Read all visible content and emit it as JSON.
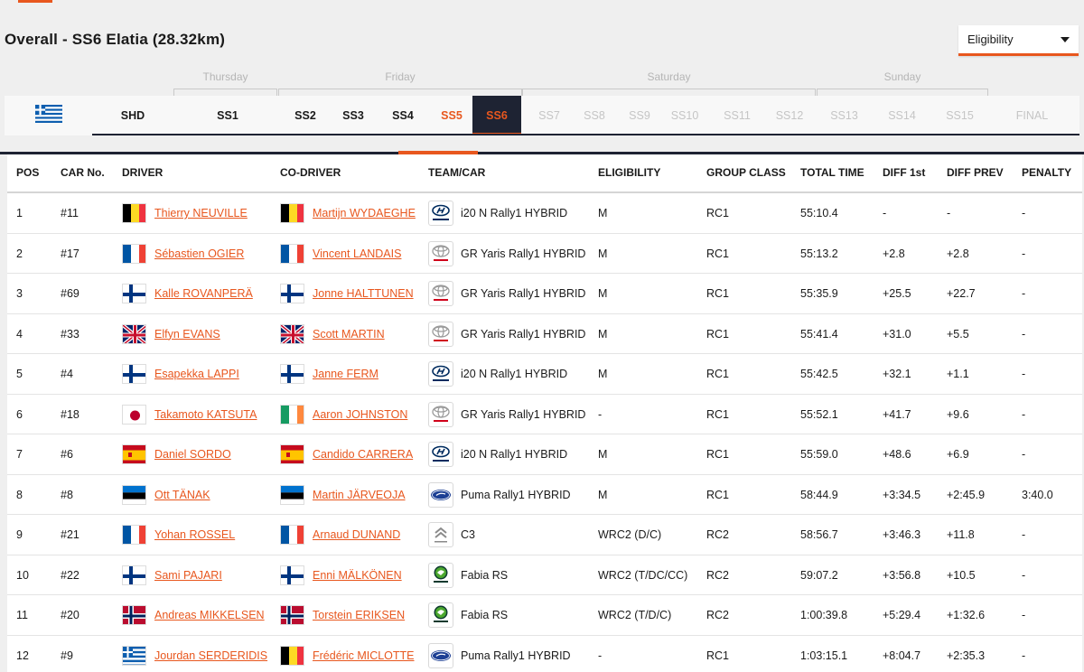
{
  "header": {
    "title": "Overall - SS6 Elatia (28.32km)",
    "eligibility_select": "Eligibility"
  },
  "days": [
    "Thursday",
    "Friday",
    "Saturday",
    "Sunday"
  ],
  "stages": [
    {
      "label": "SHD",
      "state": "done"
    },
    {
      "label": "SS1",
      "state": "done"
    },
    {
      "label": "SS2",
      "state": "done"
    },
    {
      "label": "SS3",
      "state": "done"
    },
    {
      "label": "SS4",
      "state": "done"
    },
    {
      "label": "SS5",
      "state": "prev"
    },
    {
      "label": "SS6",
      "state": "active"
    },
    {
      "label": "SS7",
      "state": "future"
    },
    {
      "label": "SS8",
      "state": "future"
    },
    {
      "label": "SS9",
      "state": "future"
    },
    {
      "label": "SS10",
      "state": "future"
    },
    {
      "label": "SS11",
      "state": "future"
    },
    {
      "label": "SS12",
      "state": "future"
    },
    {
      "label": "SS13",
      "state": "future"
    },
    {
      "label": "SS14",
      "state": "future"
    },
    {
      "label": "SS15",
      "state": "future"
    },
    {
      "label": "FINAL",
      "state": "future"
    }
  ],
  "columns": [
    "POS",
    "CAR No.",
    "DRIVER",
    "CO-DRIVER",
    "TEAM/CAR",
    "ELIGIBILITY",
    "GROUP CLASS",
    "TOTAL TIME",
    "DIFF 1st",
    "DIFF PREV",
    "PENALTY"
  ],
  "rows": [
    {
      "pos": "1",
      "car": "#11",
      "driver": "Thierry NEUVILLE",
      "driver_flag": "BE",
      "codriver": "Martijn WYDAEGHE",
      "codriver_flag": "BE",
      "team_logo": "hyundai",
      "team": "i20 N Rally1 HYBRID",
      "elig": "M",
      "group": "RC1",
      "total": "55:10.4",
      "diff1": "-",
      "diffprev": "-",
      "penalty": "-"
    },
    {
      "pos": "2",
      "car": "#17",
      "driver": "Sébastien OGIER",
      "driver_flag": "FR",
      "codriver": "Vincent LANDAIS",
      "codriver_flag": "FR",
      "team_logo": "toyota",
      "team": "GR Yaris Rally1 HYBRID",
      "elig": "M",
      "group": "RC1",
      "total": "55:13.2",
      "diff1": "+2.8",
      "diffprev": "+2.8",
      "penalty": "-"
    },
    {
      "pos": "3",
      "car": "#69",
      "driver": "Kalle ROVANPERÄ",
      "driver_flag": "FI",
      "codriver": "Jonne HALTTUNEN",
      "codriver_flag": "FI",
      "team_logo": "toyota",
      "team": "GR Yaris Rally1 HYBRID",
      "elig": "M",
      "group": "RC1",
      "total": "55:35.9",
      "diff1": "+25.5",
      "diffprev": "+22.7",
      "penalty": "-"
    },
    {
      "pos": "4",
      "car": "#33",
      "driver": "Elfyn EVANS",
      "driver_flag": "GB",
      "codriver": "Scott MARTIN",
      "codriver_flag": "GB",
      "team_logo": "toyota",
      "team": "GR Yaris Rally1 HYBRID",
      "elig": "M",
      "group": "RC1",
      "total": "55:41.4",
      "diff1": "+31.0",
      "diffprev": "+5.5",
      "penalty": "-"
    },
    {
      "pos": "5",
      "car": "#4",
      "driver": "Esapekka LAPPI",
      "driver_flag": "FI",
      "codriver": "Janne FERM",
      "codriver_flag": "FI",
      "team_logo": "hyundai",
      "team": "i20 N Rally1 HYBRID",
      "elig": "M",
      "group": "RC1",
      "total": "55:42.5",
      "diff1": "+32.1",
      "diffprev": "+1.1",
      "penalty": "-"
    },
    {
      "pos": "6",
      "car": "#18",
      "driver": "Takamoto KATSUTA",
      "driver_flag": "JP",
      "codriver": "Aaron JOHNSTON",
      "codriver_flag": "IE",
      "team_logo": "toyota",
      "team": "GR Yaris Rally1 HYBRID",
      "elig": "-",
      "group": "RC1",
      "total": "55:52.1",
      "diff1": "+41.7",
      "diffprev": "+9.6",
      "penalty": "-"
    },
    {
      "pos": "7",
      "car": "#6",
      "driver": "Daniel SORDO",
      "driver_flag": "ES",
      "codriver": "Candido CARRERA",
      "codriver_flag": "ES",
      "team_logo": "hyundai",
      "team": "i20 N Rally1 HYBRID",
      "elig": "M",
      "group": "RC1",
      "total": "55:59.0",
      "diff1": "+48.6",
      "diffprev": "+6.9",
      "penalty": "-"
    },
    {
      "pos": "8",
      "car": "#8",
      "driver": "Ott TÄNAK",
      "driver_flag": "EE",
      "codriver": "Martin JÄRVEOJA",
      "codriver_flag": "EE",
      "team_logo": "ford",
      "team": "Puma Rally1 HYBRID",
      "elig": "M",
      "group": "RC1",
      "total": "58:44.9",
      "diff1": "+3:34.5",
      "diffprev": "+2:45.9",
      "penalty": "3:40.0"
    },
    {
      "pos": "9",
      "car": "#21",
      "driver": "Yohan ROSSEL",
      "driver_flag": "FR",
      "codriver": "Arnaud DUNAND",
      "codriver_flag": "FR",
      "team_logo": "citroen",
      "team": "C3",
      "elig": "WRC2 (D/C)",
      "group": "RC2",
      "total": "58:56.7",
      "diff1": "+3:46.3",
      "diffprev": "+11.8",
      "penalty": "-"
    },
    {
      "pos": "10",
      "car": "#22",
      "driver": "Sami PAJARI",
      "driver_flag": "FI",
      "codriver": "Enni MÄLKÖNEN",
      "codriver_flag": "FI",
      "team_logo": "skoda",
      "team": "Fabia RS",
      "elig": "WRC2 (T/DC/CC)",
      "group": "RC2",
      "total": "59:07.2",
      "diff1": "+3:56.8",
      "diffprev": "+10.5",
      "penalty": "-"
    },
    {
      "pos": "11",
      "car": "#20",
      "driver": "Andreas MIKKELSEN",
      "driver_flag": "NO",
      "codriver": "Torstein ERIKSEN",
      "codriver_flag": "NO",
      "team_logo": "skoda",
      "team": "Fabia RS",
      "elig": "WRC2 (T/D/C)",
      "group": "RC2",
      "total": "1:00:39.8",
      "diff1": "+5:29.4",
      "diffprev": "+1:32.6",
      "penalty": "-"
    },
    {
      "pos": "12",
      "car": "#9",
      "driver": "Jourdan SERDERIDIS",
      "driver_flag": "GR",
      "codriver": "Frédéric MICLOTTE",
      "codriver_flag": "BE",
      "team_logo": "ford",
      "team": "Puma Rally1 HYBRID",
      "elig": "-",
      "group": "RC1",
      "total": "1:03:15.1",
      "diff1": "+8:04.7",
      "diffprev": "+2:35.3",
      "penalty": "-"
    }
  ],
  "colors": {
    "accent": "#e8571e",
    "navy": "#1e2333"
  }
}
